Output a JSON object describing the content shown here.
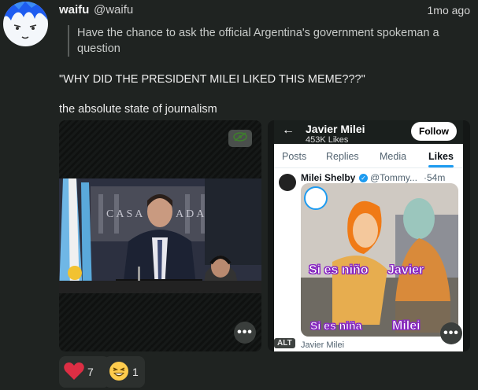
{
  "post": {
    "display_name": "waifu",
    "handle": "@waifu",
    "time": "1mo ago",
    "quote": "Have the chance to ask the official Argentina's government spokeman a question",
    "line1": "\"WHY DID THE PRESIDENT MILEI LIKED THIS MEME???\"",
    "line2": "the absolute state of journalism"
  },
  "media_left": {
    "sign_left": "CASA",
    "sign_right": "ADA"
  },
  "media_right": {
    "profile_name": "Javier Milei",
    "profile_sub": "453K Likes",
    "follow_label": "Follow",
    "tabs": [
      "Posts",
      "Replies",
      "Media",
      "Likes"
    ],
    "tweet_author": "Milei Shelby",
    "tweet_handle": "@Tommy...",
    "tweet_time": "·54m",
    "meme_text_1": "Si es niño",
    "meme_text_2": "Javier",
    "meme_text_3": "Si es niña",
    "meme_text_4": "Milei",
    "alt_badge": "ALT",
    "caption": "Javier Milei"
  },
  "reactions": [
    {
      "icon": "heart-icon",
      "count": "7"
    },
    {
      "icon": "laughing-emoji-icon",
      "count": "1"
    }
  ],
  "more_label": "•••",
  "colors": {
    "background": "#1f2321",
    "twitter_blue": "#1d9bf0",
    "heart": "#dd2e44"
  }
}
